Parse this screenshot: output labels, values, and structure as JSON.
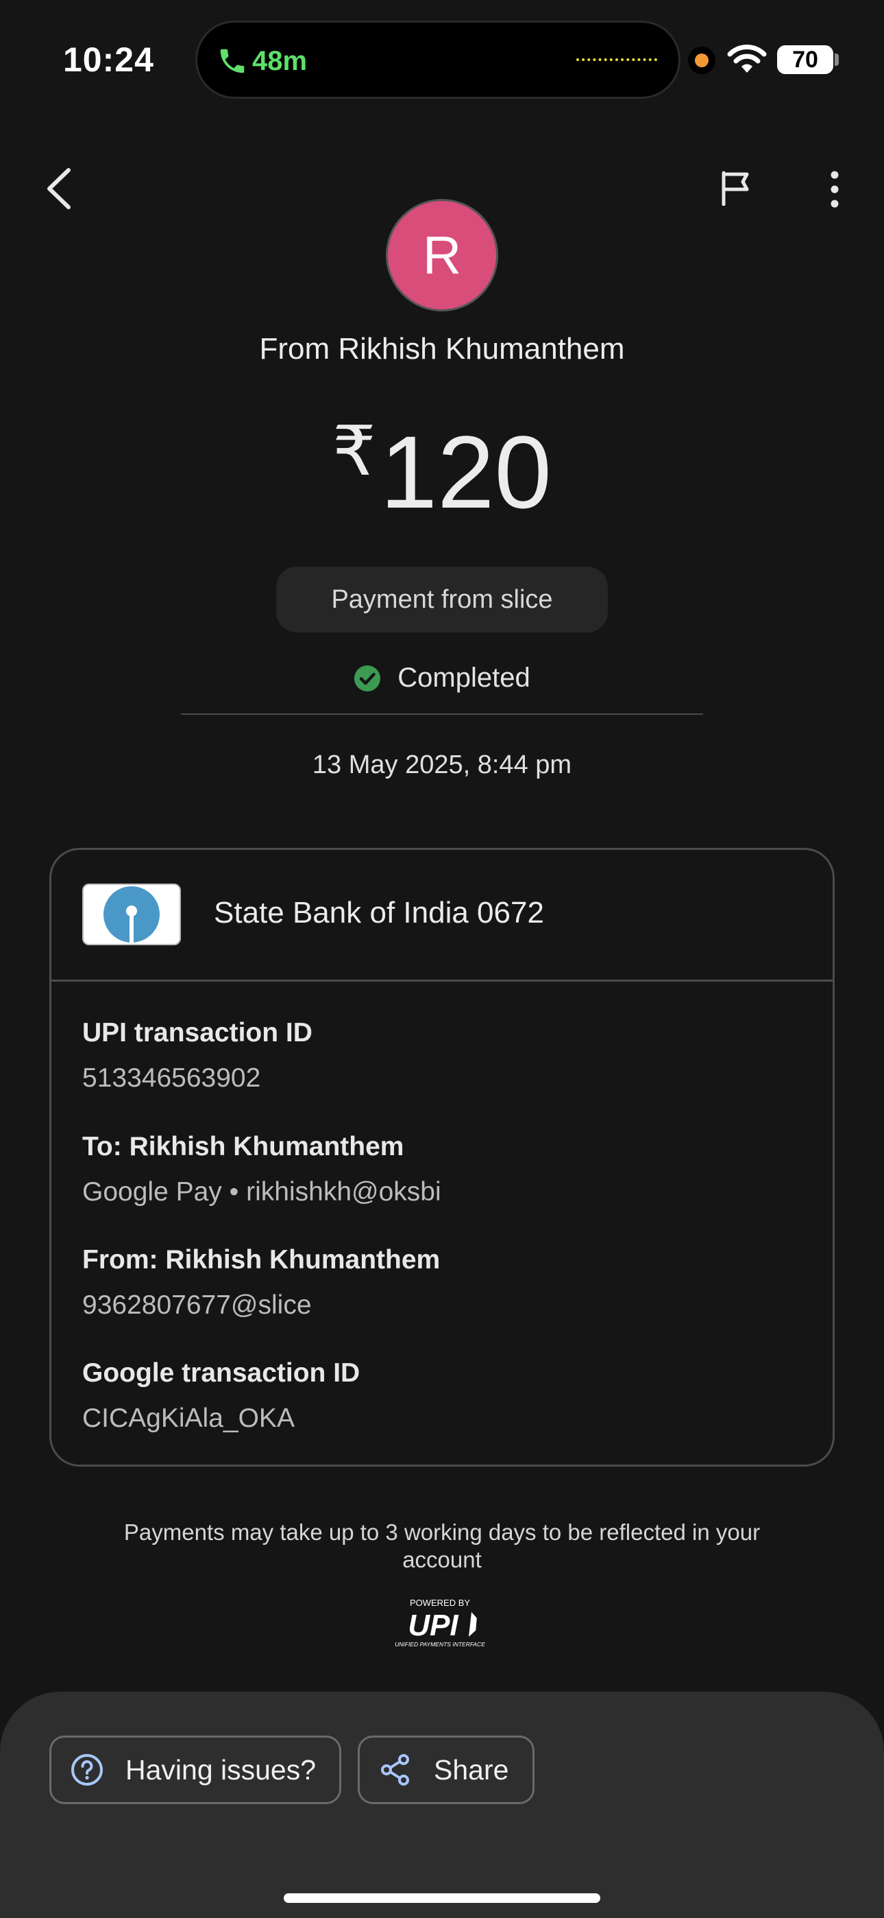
{
  "status_bar": {
    "time": "10:24",
    "call_timer": "48m",
    "battery": "70"
  },
  "header": {
    "avatar_initial": "R",
    "title": "From Rikhish Khumanthem",
    "currency": "₹",
    "amount": "120",
    "note": "Payment from slice",
    "status": "Completed",
    "datetime": "13 May 2025, 8:44 pm"
  },
  "card": {
    "bank": "State Bank of India 0672",
    "details": [
      {
        "label": "UPI transaction ID",
        "value": "513346563902"
      },
      {
        "label": "To: Rikhish  Khumanthem",
        "value": "Google Pay • rikhishkh@oksbi"
      },
      {
        "label": "From: Rikhish Khumanthem",
        "value": "9362807677@slice"
      },
      {
        "label": "Google transaction ID",
        "value": "CICAgKiAla_OKA"
      }
    ]
  },
  "footer": {
    "disclaimer": "Payments may take up to 3 working days to be reflected in your account",
    "upi_powered_by": "POWERED BY",
    "upi_wordmark": "UPI",
    "upi_tagline": "UNIFIED PAYMENTS INTERFACE"
  },
  "actions": {
    "issues_label": "Having issues?",
    "share_label": "Share"
  },
  "colors": {
    "background": "#151515",
    "avatar": "#d94d7a",
    "status_success": "#3c9a52",
    "call_green": "#5ee06a",
    "sheet": "#2e2e2e",
    "accent_icon": "#a8c7fa"
  },
  "icons": [
    "phone-icon",
    "wifi-icon",
    "back-arrow-icon",
    "flag-icon",
    "more-vert-icon",
    "check-circle-icon",
    "sbi-logo",
    "upi-logo",
    "help-circle-icon",
    "share-icon"
  ]
}
